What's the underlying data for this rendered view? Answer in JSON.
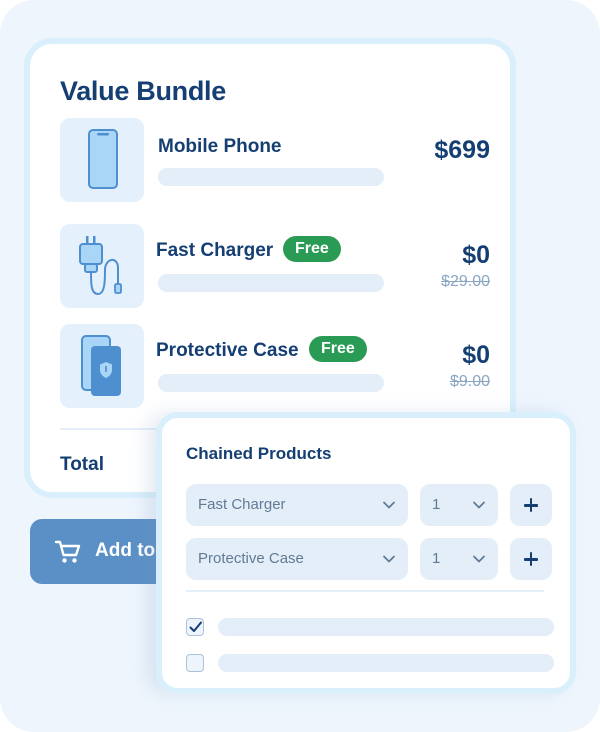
{
  "bundle": {
    "title": "Value Bundle",
    "products": [
      {
        "name": "Mobile Phone",
        "price": "$699",
        "old_price": "",
        "badge": "",
        "icon": "phone-icon"
      },
      {
        "name": "Fast Charger",
        "price": "$0",
        "old_price": "$29.00",
        "badge": "Free",
        "icon": "charger-icon"
      },
      {
        "name": "Protective Case",
        "price": "$0",
        "old_price": "$9.00",
        "badge": "Free",
        "icon": "case-icon"
      }
    ],
    "total_label": "Total",
    "add_to_cart_label": "Add to"
  },
  "chained": {
    "title": "Chained Products",
    "rows": [
      {
        "product": "Fast Charger",
        "quantity": "1"
      },
      {
        "product": "Protective Case",
        "quantity": "1"
      }
    ],
    "checkboxes": [
      {
        "checked": true
      },
      {
        "checked": false
      }
    ]
  },
  "colors": {
    "heading": "#153f73",
    "free_badge": "#2a9b55",
    "cart_button": "#5b90c6",
    "card_border": "#d9f0fc",
    "skeleton": "#e3eef9"
  }
}
